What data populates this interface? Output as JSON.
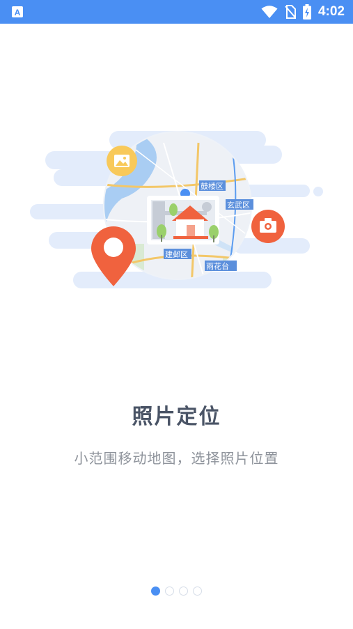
{
  "status_bar": {
    "time": "4:02",
    "left_icon": "keyboard-a-icon",
    "icons": [
      "wifi-icon",
      "no-sim-icon",
      "battery-charging-icon"
    ]
  },
  "illustration": {
    "map_labels": [
      "鼓楼区",
      "玄武区",
      "建邺区",
      "雨花台"
    ],
    "icons": [
      "image-icon",
      "camera-icon",
      "location-pin-icon",
      "house-icon"
    ]
  },
  "onboarding": {
    "title": "照片定位",
    "subtitle": "小范围移动地图，选择照片位置"
  },
  "pager": {
    "total": 4,
    "active_index": 0
  },
  "colors": {
    "status_bar": "#4a8ff3",
    "accent_orange": "#f0623e",
    "accent_yellow": "#f8c95a",
    "title": "#4a5466",
    "subtitle": "#8e939b",
    "cloud": "#e3ecfb"
  }
}
